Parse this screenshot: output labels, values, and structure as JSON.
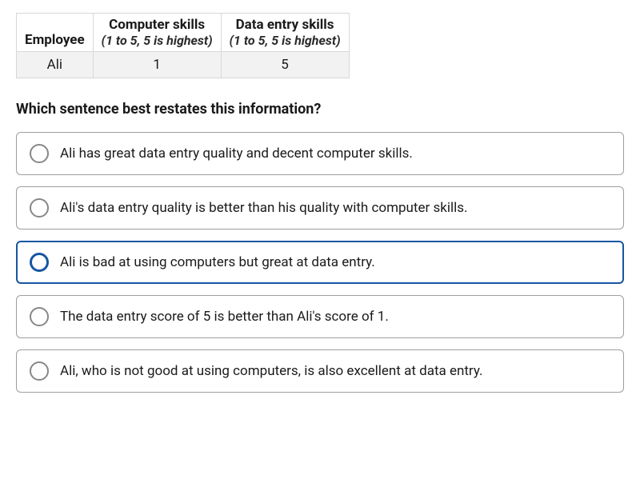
{
  "table": {
    "headers": {
      "employee": "Employee",
      "col1_top": "Computer skills",
      "col1_sub": "(1 to 5, 5 is highest)",
      "col2_top": "Data entry skills",
      "col2_sub": "(1 to 5, 5 is highest)"
    },
    "row": {
      "name": "Ali",
      "computer": "1",
      "data_entry": "5"
    }
  },
  "question": "Which sentence best restates this information?",
  "options": [
    {
      "text": "Ali has great data entry quality and decent computer skills.",
      "selected": false
    },
    {
      "text": "Ali's data entry quality is better than his quality with computer skills.",
      "selected": false
    },
    {
      "text": "Ali is bad at using computers but great at data entry.",
      "selected": true
    },
    {
      "text": "The data entry score of 5 is better than Ali's score of 1.",
      "selected": false
    },
    {
      "text": "Ali, who is not good at using computers, is also excellent at data entry.",
      "selected": false
    }
  ]
}
